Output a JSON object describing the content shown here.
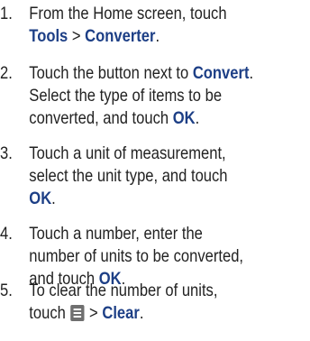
{
  "steps": [
    {
      "number": "1.",
      "line1": "From the Home screen, touch",
      "kw_tools": "Tools",
      "sep": " > ",
      "kw_converter": "Converter",
      "end": "."
    },
    {
      "number": "2.",
      "line1_pre": "Touch the button next to ",
      "kw_convert": "Convert",
      "line1_end": ".",
      "line2": "Select the type of items to be",
      "line3_pre": "converted, and touch ",
      "kw_ok": "OK",
      "end": "."
    },
    {
      "number": "3.",
      "line1": "Touch a unit of measurement,",
      "line2": "select the unit type, and touch",
      "kw_ok": "OK",
      "end": "."
    },
    {
      "number": "4.",
      "line1": "Touch a number, enter the",
      "line2": "number of units to be converted,",
      "line3_pre": "and touch ",
      "kw_ok": "OK",
      "end": "."
    },
    {
      "number": "5.",
      "line1": "To clear the number of units,",
      "line2_pre": "touch ",
      "icon": "menu-icon",
      "sep": " > ",
      "kw_clear": "Clear",
      "end": "."
    }
  ]
}
